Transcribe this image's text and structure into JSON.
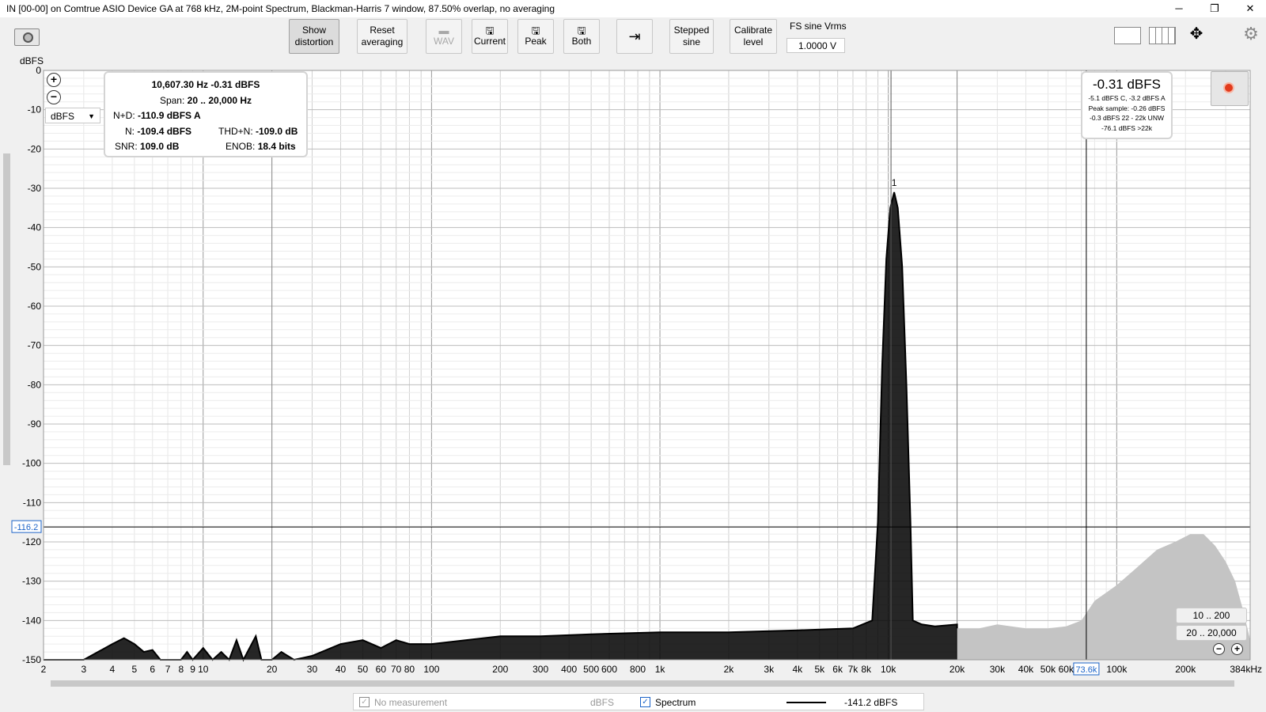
{
  "window": {
    "title": "IN [00-00] on Comtrue ASIO Device GA at 768 kHz, 2M-point Spectrum, Blackman-Harris 7 window, 87.50% overlap, no averaging",
    "minimize": "─",
    "maximize": "❐",
    "close": "✕"
  },
  "toolbar": {
    "show_distortion": [
      "Show",
      "distortion"
    ],
    "reset_averaging": [
      "Reset",
      "averaging"
    ],
    "wav": "WAV",
    "current": "Current",
    "peak": "Peak",
    "both": "Both",
    "stepped_sine": [
      "Stepped",
      "sine"
    ],
    "calibrate_level": [
      "Calibrate",
      "level"
    ],
    "fs_sine_label": "FS sine Vrms",
    "fs_sine_value": "1.0000 V"
  },
  "readout": {
    "freq_level": "10,607.30 Hz  -0.31 dBFS",
    "span_label": "Span:",
    "span_value": "20 .. 20,000 Hz",
    "nd_label": "N+D:",
    "nd_value": "-110.9 dBFS A",
    "n_label": "N:",
    "n_value": "-109.4 dBFS",
    "thdn_label": "THD+N:",
    "thdn_value": "-109.0 dB",
    "snr_label": "SNR:",
    "snr_value": "109.0 dB",
    "enob_label": "ENOB:",
    "enob_value": "18.4 bits"
  },
  "level_box": {
    "main": "-0.31 dBFS",
    "lines": [
      "-5.1 dBFS C, -3.2 dBFS A",
      "Peak sample: -0.26 dBFS",
      "-0.3 dBFS 22 - 22k UNW",
      "-76.1 dBFS >22k"
    ]
  },
  "unit_select": "dBFS",
  "range_buttons": [
    "10 .. 200",
    "20 .. 20,000"
  ],
  "bottom": {
    "no_measurement": "No measurement",
    "unit": "dBFS",
    "spectrum": "Spectrum",
    "cursor_value": "-141.2 dBFS"
  },
  "chart_data": {
    "type": "line",
    "title": "",
    "ylabel": "dBFS",
    "xlabel": "",
    "x_scale": "log",
    "xlim": [
      2,
      384000
    ],
    "ylim": [
      -150,
      0
    ],
    "y_ticks": [
      0,
      -10,
      -20,
      -30,
      -40,
      -50,
      -60,
      -70,
      -80,
      -90,
      -100,
      -110,
      -120,
      -130,
      -140,
      -150
    ],
    "x_tick_labels": [
      {
        "v": 2,
        "t": "2"
      },
      {
        "v": 3,
        "t": "3"
      },
      {
        "v": 4,
        "t": "4"
      },
      {
        "v": 5,
        "t": "5"
      },
      {
        "v": 6,
        "t": "6"
      },
      {
        "v": 7,
        "t": "7"
      },
      {
        "v": 8,
        "t": "8"
      },
      {
        "v": 9,
        "t": "9"
      },
      {
        "v": 10,
        "t": "10"
      },
      {
        "v": 20,
        "t": "20"
      },
      {
        "v": 30,
        "t": "30"
      },
      {
        "v": 40,
        "t": "40"
      },
      {
        "v": 50,
        "t": "50"
      },
      {
        "v": 60,
        "t": "60"
      },
      {
        "v": 70,
        "t": "70"
      },
      {
        "v": 80,
        "t": "80"
      },
      {
        "v": 100,
        "t": "100"
      },
      {
        "v": 200,
        "t": "200"
      },
      {
        "v": 300,
        "t": "300"
      },
      {
        "v": 400,
        "t": "400"
      },
      {
        "v": 500,
        "t": "500"
      },
      {
        "v": 600,
        "t": "600"
      },
      {
        "v": 800,
        "t": "800"
      },
      {
        "v": 1000,
        "t": "1k"
      },
      {
        "v": 2000,
        "t": "2k"
      },
      {
        "v": 3000,
        "t": "3k"
      },
      {
        "v": 4000,
        "t": "4k"
      },
      {
        "v": 5000,
        "t": "5k"
      },
      {
        "v": 6000,
        "t": "6k"
      },
      {
        "v": 7000,
        "t": "7k"
      },
      {
        "v": 8000,
        "t": "8k"
      },
      {
        "v": 10000,
        "t": "10k"
      },
      {
        "v": 20000,
        "t": "20k"
      },
      {
        "v": 30000,
        "t": "30k"
      },
      {
        "v": 40000,
        "t": "40k"
      },
      {
        "v": 50000,
        "t": "50k"
      },
      {
        "v": 60000,
        "t": "60k"
      },
      {
        "v": 100000,
        "t": "100k"
      },
      {
        "v": 200000,
        "t": "200k"
      },
      {
        "v": 384000,
        "t": "384kHz"
      }
    ],
    "peak": {
      "freq": 10607.3,
      "level": -31,
      "label": "1"
    },
    "cursor": {
      "y": -116.2,
      "y_label": "-116.2",
      "x": 73600,
      "x_label": "73.6k"
    },
    "analysis_span": [
      20,
      20000
    ],
    "series": [
      {
        "name": "Spectrum",
        "color": "#000000",
        "points": [
          [
            2,
            -150
          ],
          [
            3,
            -150
          ],
          [
            4,
            -146
          ],
          [
            4.5,
            -144.5
          ],
          [
            5,
            -146
          ],
          [
            5.5,
            -148
          ],
          [
            6,
            -147.5
          ],
          [
            6.5,
            -150
          ],
          [
            8,
            -150
          ],
          [
            8.5,
            -148
          ],
          [
            9,
            -150
          ],
          [
            10,
            -147
          ],
          [
            11,
            -150
          ],
          [
            12,
            -148
          ],
          [
            13,
            -150
          ],
          [
            14,
            -145
          ],
          [
            15,
            -150
          ],
          [
            17,
            -144
          ],
          [
            18,
            -150
          ],
          [
            20,
            -150
          ],
          [
            22,
            -148
          ],
          [
            25,
            -150
          ],
          [
            30,
            -149
          ],
          [
            40,
            -146
          ],
          [
            50,
            -145
          ],
          [
            60,
            -147
          ],
          [
            70,
            -145
          ],
          [
            80,
            -146
          ],
          [
            100,
            -146
          ],
          [
            200,
            -144
          ],
          [
            300,
            -144
          ],
          [
            500,
            -143.5
          ],
          [
            1000,
            -143
          ],
          [
            2000,
            -143
          ],
          [
            4000,
            -142.5
          ],
          [
            7000,
            -142
          ],
          [
            8500,
            -140
          ],
          [
            9000,
            -115
          ],
          [
            9400,
            -75
          ],
          [
            9800,
            -48
          ],
          [
            10200,
            -35
          ],
          [
            10607.3,
            -31
          ],
          [
            11000,
            -35
          ],
          [
            11500,
            -50
          ],
          [
            12000,
            -80
          ],
          [
            12500,
            -115
          ],
          [
            12800,
            -140
          ],
          [
            14000,
            -141
          ],
          [
            16000,
            -141.5
          ],
          [
            20000,
            -141
          ],
          [
            20000,
            -150
          ]
        ]
      },
      {
        "name": "Spectrum >20k",
        "color": "#c4c4c4",
        "points": [
          [
            20000,
            -142
          ],
          [
            25000,
            -142
          ],
          [
            30000,
            -141
          ],
          [
            40000,
            -142
          ],
          [
            50000,
            -142
          ],
          [
            60000,
            -141.5
          ],
          [
            70000,
            -140
          ],
          [
            80000,
            -135
          ],
          [
            100000,
            -131
          ],
          [
            120000,
            -127
          ],
          [
            150000,
            -122
          ],
          [
            180000,
            -120
          ],
          [
            210000,
            -118
          ],
          [
            240000,
            -118
          ],
          [
            270000,
            -121
          ],
          [
            300000,
            -125
          ],
          [
            330000,
            -130
          ],
          [
            360000,
            -138
          ],
          [
            384000,
            -145
          ]
        ]
      }
    ]
  }
}
